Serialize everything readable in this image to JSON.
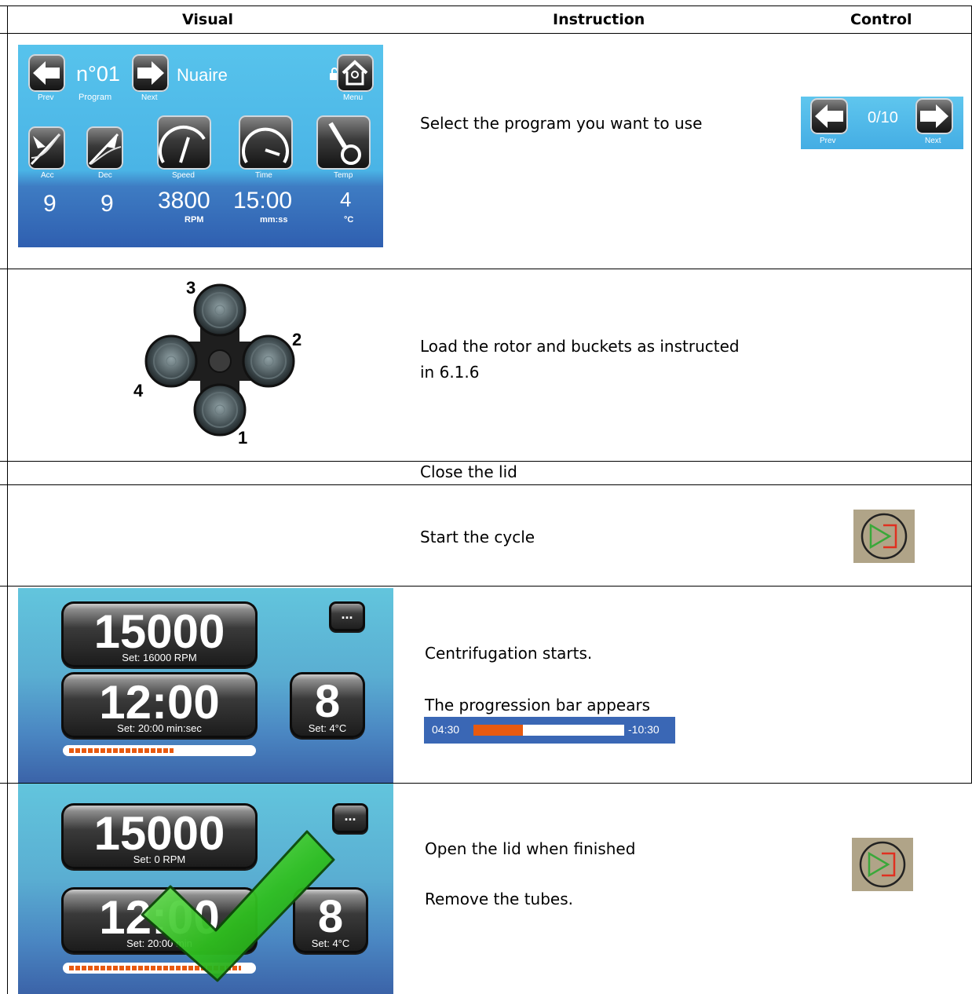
{
  "headers": {
    "visual": "Visual",
    "instruction": "Instruction",
    "control": "Control"
  },
  "program_screen": {
    "program_number": "n°01",
    "program_name": "Nuaire",
    "prev_label": "Prev",
    "program_label": "Program",
    "next_label": "Next",
    "menu_label": "Menu",
    "param_labels": [
      "Acc",
      "Dec",
      "Speed",
      "Time",
      "Temp"
    ],
    "param_values": [
      "9",
      "9",
      "3800",
      "15:00",
      "4"
    ],
    "units": {
      "speed": "RPM",
      "time": "mm:ss",
      "temp": "°C"
    }
  },
  "program_selector": {
    "value": "0/10",
    "prev_label": "Prev",
    "next_label": "Next"
  },
  "rotor": {
    "positions": [
      "1",
      "2",
      "3",
      "4"
    ]
  },
  "steps": [
    {
      "instruction": "Select the program you want to use"
    },
    {
      "instruction": "Load the rotor and buckets as instructed",
      "instruction_line2": "in  6.1.6"
    },
    {
      "instruction": "Close the lid"
    },
    {
      "instruction": "Start the cycle"
    },
    {
      "instruction": "Centrifugation starts.",
      "instruction_line2": "The progression bar  appears"
    },
    {
      "instruction": "Open the lid when finished",
      "instruction_line2": "Remove the tubes."
    }
  ],
  "run_screen": {
    "speed": "15000",
    "speed_set": "Set: 16000 RPM",
    "time": "12:00",
    "time_set": "Set: 20:00 min:sec",
    "temp": "8",
    "temp_set": "Set: 4°C",
    "more_button": "..."
  },
  "finished_screen": {
    "speed": "15000",
    "speed_set": "Set:      0 RPM",
    "time": "12:00",
    "time_set": "Set: 20:00 min",
    "temp": "8",
    "temp_set": "Set: 4°C",
    "more_button": "..."
  },
  "progression_bar": {
    "elapsed": "04:30",
    "remaining": "-10:30",
    "fraction": 0.33
  },
  "run_progress_fraction": 0.58,
  "finished_progress_fraction": 0.95,
  "colors": {
    "progress_fill": "#e85a10",
    "check_green": "#2fbf1f",
    "power_green": "#3aa83a",
    "power_red": "#e03020"
  }
}
